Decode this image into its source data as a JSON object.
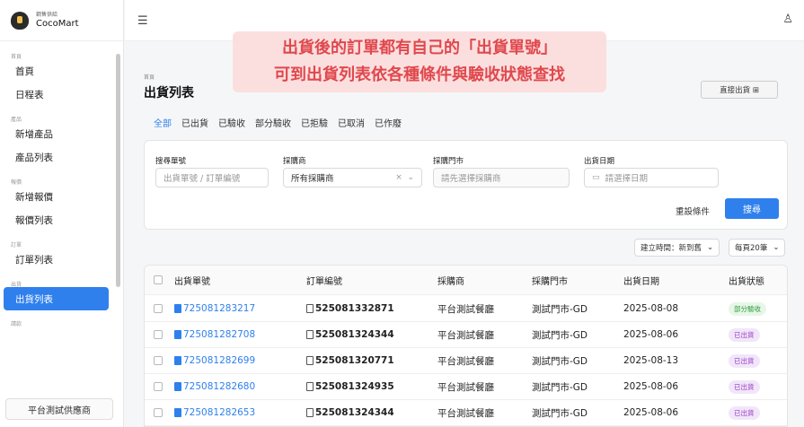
{
  "brand": {
    "sub": "鋼售供給",
    "name": "CocoMart"
  },
  "sidebar": {
    "groups": [
      {
        "label": "首頁",
        "items": [
          "首頁",
          "日程表"
        ]
      },
      {
        "label": "產品",
        "items": [
          "新增產品",
          "產品列表"
        ]
      },
      {
        "label": "報價",
        "items": [
          "新增報價",
          "報價列表"
        ]
      },
      {
        "label": "訂單",
        "items": [
          "訂單列表"
        ]
      },
      {
        "label": "出貨",
        "items": [
          "出貨列表"
        ]
      },
      {
        "label": "請款",
        "items": []
      }
    ],
    "active": "出貨列表",
    "vendor_button": "平台測試供應商"
  },
  "icons": {
    "menu": "menu-collapse-icon",
    "user": "user-icon",
    "calendar": "calendar-icon",
    "doc": "document-icon"
  },
  "banner": {
    "line1": "出貨後的訂單都有自己的「出貨單號」",
    "line2": "可到出貨列表依各種條件與驗收狀態查找"
  },
  "page": {
    "breadcrumb": "首頁",
    "title": "出貨列表",
    "direct_ship": "直接出貨 ⊞"
  },
  "tabs": [
    "全部",
    "已出貨",
    "已驗收",
    "部分驗收",
    "已拒驗",
    "已取消",
    "已作廢"
  ],
  "filters": {
    "ship_no": {
      "label": "搜尋單號",
      "placeholder": "出貨單號 / 訂單編號"
    },
    "buyer": {
      "label": "採購商",
      "value": "所有採購商"
    },
    "store": {
      "label": "採購門市",
      "placeholder": "請先選擇採購商"
    },
    "date": {
      "label": "出貨日期",
      "placeholder": "請選擇日期"
    },
    "reset": "重設條件",
    "search": "搜尋"
  },
  "sort": {
    "order": "建立時間：新到舊",
    "page_size": "每頁20筆"
  },
  "table": {
    "headers": [
      "出貨單號",
      "訂單編號",
      "採購商",
      "採購門市",
      "出貨日期",
      "出貨狀態"
    ],
    "rows": [
      {
        "ship_no": "725081283217",
        "order_no": "525081332871",
        "buyer": "平台測試餐廳",
        "store": "測試門市-GD",
        "date": "2025-08-08",
        "status": "部分驗收",
        "kind": "partial"
      },
      {
        "ship_no": "725081282708",
        "order_no": "525081324344",
        "buyer": "平台測試餐廳",
        "store": "測試門市-GD",
        "date": "2025-08-06",
        "status": "已出貨",
        "kind": "shipped"
      },
      {
        "ship_no": "725081282699",
        "order_no": "525081320771",
        "buyer": "平台測試餐廳",
        "store": "測試門市-GD",
        "date": "2025-08-13",
        "status": "已出貨",
        "kind": "shipped"
      },
      {
        "ship_no": "725081282680",
        "order_no": "525081324935",
        "buyer": "平台測試餐廳",
        "store": "測試門市-GD",
        "date": "2025-08-06",
        "status": "已出貨",
        "kind": "shipped"
      },
      {
        "ship_no": "725081282653",
        "order_no": "525081324344",
        "buyer": "平台測試餐廳",
        "store": "測試門市-GD",
        "date": "2025-08-06",
        "status": "已出貨",
        "kind": "shipped"
      }
    ]
  }
}
